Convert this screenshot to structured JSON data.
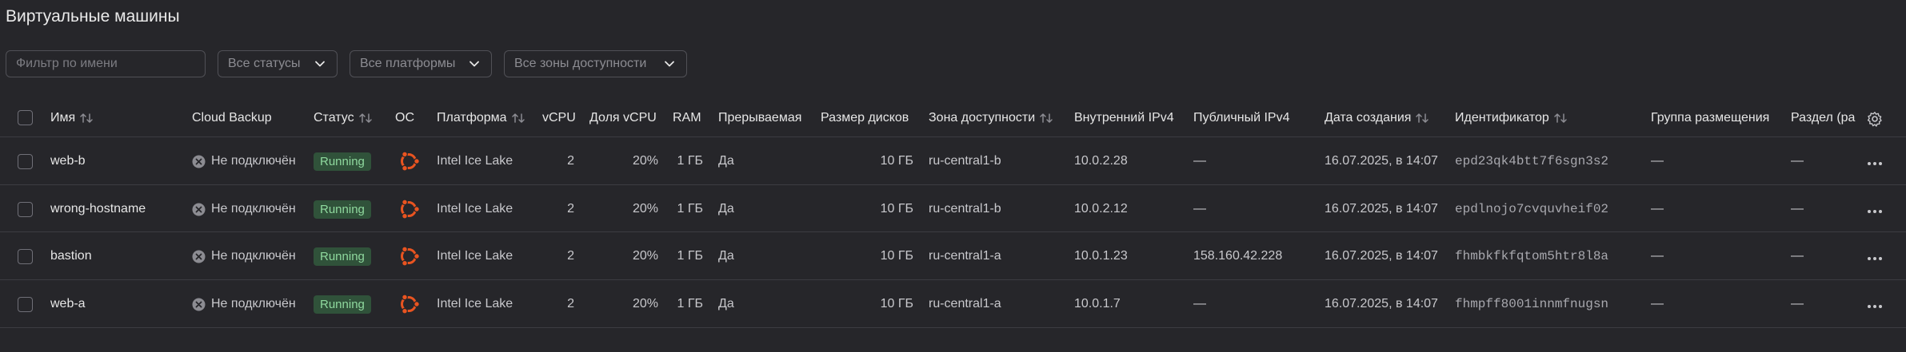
{
  "page_title": "Виртуальные машины",
  "filters": {
    "name_placeholder": "Фильтр по имени",
    "status": "Все статусы",
    "platform": "Все платформы",
    "zone": "Все зоны доступности"
  },
  "columns": {
    "name": "Имя",
    "backup": "Cloud Backup",
    "status": "Статус",
    "os": "ОС",
    "platform": "Платформа",
    "vcpu": "vCPU",
    "vcpu_share": "Доля vCPU",
    "ram": "RAM",
    "preemptible": "Прерываемая",
    "disk_size": "Размер дисков",
    "zone": "Зона доступности",
    "internal_ip": "Внутренний IPv4",
    "public_ip": "Публичный IPv4",
    "created": "Дата создания",
    "id": "Идентификатор",
    "placement": "Группа размещения",
    "partition": "Раздел (ра"
  },
  "colors": {
    "running_bg": "#30523a",
    "running_fg": "#8fd99e",
    "os_icon": "#e95420"
  },
  "rows": [
    {
      "name": "web-b",
      "backup": "Не подключён",
      "status": "Running",
      "os_icon": "ubuntu-icon",
      "platform": "Intel Ice Lake",
      "vcpu": "2",
      "vcpu_share": "20%",
      "ram": "1 ГБ",
      "preemptible": "Да",
      "disk_size": "10 ГБ",
      "zone": "ru-central1-b",
      "internal_ip": "10.0.2.28",
      "public_ip": "—",
      "created": "16.07.2025, в 14:07",
      "id": "epd23qk4btt7f6sgn3s2",
      "placement": "—",
      "partition": "—"
    },
    {
      "name": "wrong-hostname",
      "backup": "Не подключён",
      "status": "Running",
      "os_icon": "ubuntu-icon",
      "platform": "Intel Ice Lake",
      "vcpu": "2",
      "vcpu_share": "20%",
      "ram": "1 ГБ",
      "preemptible": "Да",
      "disk_size": "10 ГБ",
      "zone": "ru-central1-b",
      "internal_ip": "10.0.2.12",
      "public_ip": "—",
      "created": "16.07.2025, в 14:07",
      "id": "epdlnojo7cvquvheif02",
      "placement": "—",
      "partition": "—"
    },
    {
      "name": "bastion",
      "backup": "Не подключён",
      "status": "Running",
      "os_icon": "ubuntu-icon",
      "platform": "Intel Ice Lake",
      "vcpu": "2",
      "vcpu_share": "20%",
      "ram": "1 ГБ",
      "preemptible": "Да",
      "disk_size": "10 ГБ",
      "zone": "ru-central1-a",
      "internal_ip": "10.0.1.23",
      "public_ip": "158.160.42.228",
      "created": "16.07.2025, в 14:07",
      "id": "fhmbkfkfqtom5htr8l8a",
      "placement": "—",
      "partition": "—"
    },
    {
      "name": "web-a",
      "backup": "Не подключён",
      "status": "Running",
      "os_icon": "ubuntu-icon",
      "platform": "Intel Ice Lake",
      "vcpu": "2",
      "vcpu_share": "20%",
      "ram": "1 ГБ",
      "preemptible": "Да",
      "disk_size": "10 ГБ",
      "zone": "ru-central1-a",
      "internal_ip": "10.0.1.7",
      "public_ip": "—",
      "created": "16.07.2025, в 14:07",
      "id": "fhmpff8001innmfnugsn",
      "placement": "—",
      "partition": "—"
    }
  ]
}
